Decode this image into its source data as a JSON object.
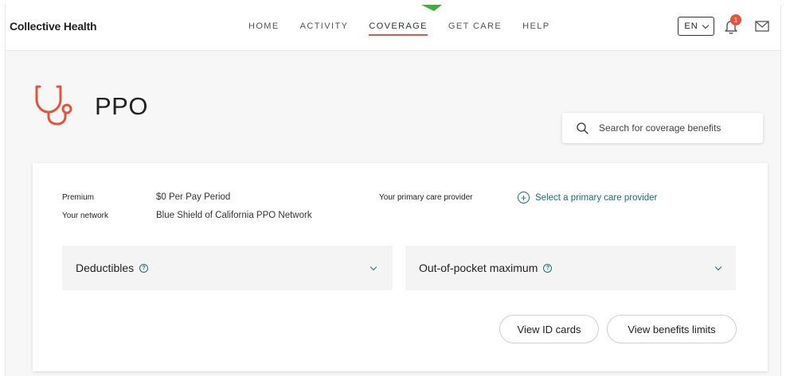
{
  "brand": "Collective Health",
  "nav": [
    {
      "label": "HOME",
      "active": false
    },
    {
      "label": "ACTIVITY",
      "active": false
    },
    {
      "label": "COVERAGE",
      "active": true
    },
    {
      "label": "GET CARE",
      "active": false
    },
    {
      "label": "HELP",
      "active": false
    }
  ],
  "language": "EN",
  "notifications_count": "1",
  "plan": {
    "title": "PPO",
    "icon": "stethoscope-icon"
  },
  "search": {
    "placeholder": "Search for coverage benefits"
  },
  "details": {
    "premium_label": "Premium",
    "premium_value": "$0 Per Pay Period",
    "network_label": "Your network",
    "network_value": "Blue Shield of California PPO Network",
    "pcp_label": "Your primary care provider",
    "pcp_action": "Select a primary care provider"
  },
  "accordions": {
    "deductibles": "Deductibles",
    "oop_max": "Out-of-pocket maximum"
  },
  "buttons": {
    "id_cards": "View ID cards",
    "benefits_limits": "View benefits limits"
  },
  "colors": {
    "accent": "#e5533d",
    "link": "#1f6d76",
    "panel": "#f4f4f4"
  }
}
